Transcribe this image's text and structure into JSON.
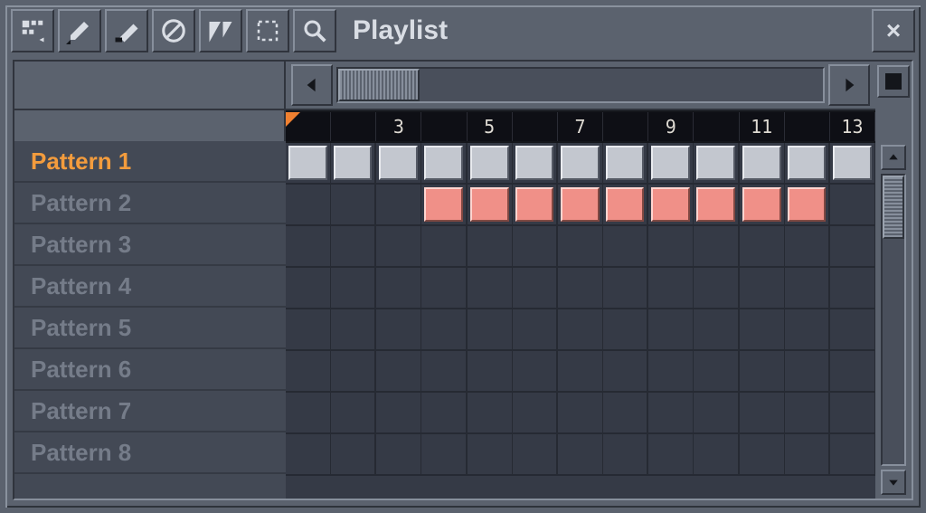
{
  "window": {
    "title": "Playlist"
  },
  "toolbar": {
    "items": [
      {
        "name": "menu-icon",
        "title": "Menu"
      },
      {
        "name": "pencil-icon",
        "title": "Draw"
      },
      {
        "name": "brush-icon",
        "title": "Paint"
      },
      {
        "name": "mute-icon",
        "title": "Mute"
      },
      {
        "name": "slice-icon",
        "title": "Slice"
      },
      {
        "name": "select-icon",
        "title": "Select"
      },
      {
        "name": "zoom-icon",
        "title": "Zoom"
      }
    ]
  },
  "timeline": {
    "ticks": [
      "",
      "",
      "3",
      "",
      "5",
      "",
      "7",
      "",
      "9",
      "",
      "11",
      "",
      "13"
    ]
  },
  "patterns": [
    {
      "label": "Pattern 1",
      "selected": true,
      "clips": [
        {
          "start": 0,
          "len": 13,
          "color": "c1"
        }
      ]
    },
    {
      "label": "Pattern 2",
      "selected": false,
      "clips": [
        {
          "start": 3,
          "len": 9,
          "color": "c2"
        }
      ]
    },
    {
      "label": "Pattern 3",
      "selected": false,
      "clips": []
    },
    {
      "label": "Pattern 4",
      "selected": false,
      "clips": []
    },
    {
      "label": "Pattern 5",
      "selected": false,
      "clips": []
    },
    {
      "label": "Pattern 6",
      "selected": false,
      "clips": []
    },
    {
      "label": "Pattern 7",
      "selected": false,
      "clips": []
    },
    {
      "label": "Pattern 8",
      "selected": false,
      "clips": []
    }
  ],
  "columns": 13
}
